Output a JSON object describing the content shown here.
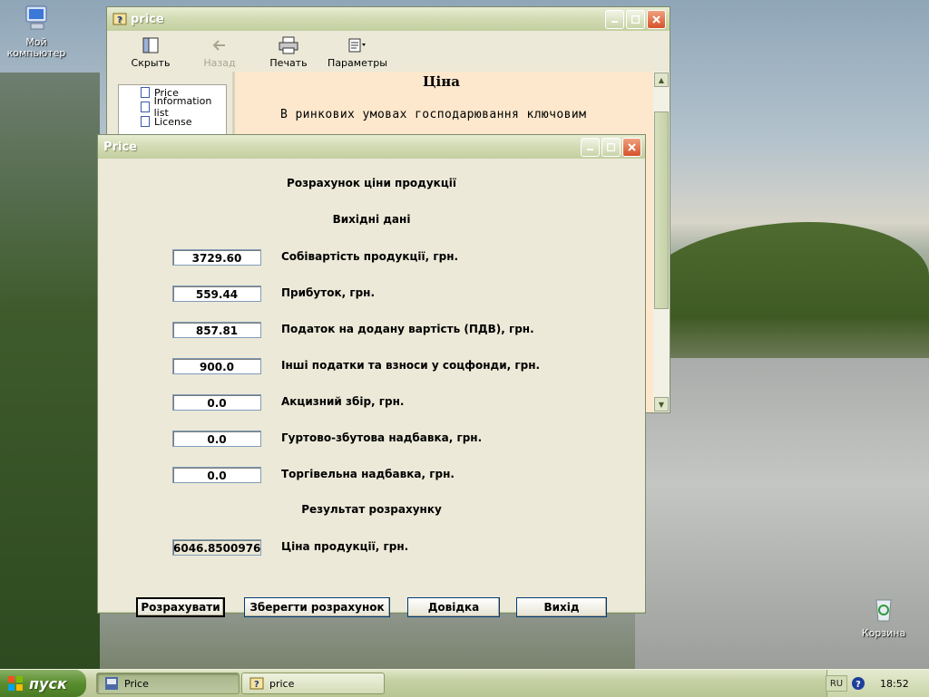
{
  "desktop": {
    "icons": [
      {
        "label_line1": "Мой",
        "label_line2": "компьютер"
      },
      {
        "label_line1": "Корзина",
        "label_line2": ""
      }
    ]
  },
  "help_window": {
    "title": "price",
    "toolbar": [
      {
        "label": "Скрыть",
        "icon": "hide-icon",
        "enabled": true
      },
      {
        "label": "Назад",
        "icon": "back-arrow-icon",
        "enabled": false
      },
      {
        "label": "Печать",
        "icon": "printer-icon",
        "enabled": true
      },
      {
        "label": "Параметры",
        "icon": "options-icon",
        "enabled": true
      }
    ],
    "toc": [
      "Price",
      "Information list",
      "License"
    ],
    "content_title": "Ціна",
    "content_text": "В  ринкових  умовах  господарювання  ключовим"
  },
  "price_dialog": {
    "title": "Price",
    "heading": "Розрахунок ціни продукції",
    "input_heading": "Вихідні дані",
    "fields": [
      {
        "value": "3729.60",
        "label": "Собівартість продукції, грн."
      },
      {
        "value": "559.44",
        "label": "Прибуток, грн."
      },
      {
        "value": "857.81",
        "label": "Податок на додану вартість (ПДВ), грн."
      },
      {
        "value": "900.0",
        "label": "Інші податки та взноси у соцфонди, грн."
      },
      {
        "value": "0.0",
        "label": "Акцизний збір, грн."
      },
      {
        "value": "0.0",
        "label": "Гуртово-збутова надбавка, грн."
      },
      {
        "value": "0.0",
        "label": "Торгівельна надбавка, грн."
      }
    ],
    "result_heading": "Результат розрахунку",
    "result": {
      "value": "6046.8500976",
      "label": "Ціна продукції, грн."
    },
    "buttons": {
      "calculate": "Розрахувати",
      "save": "Зберегти розрахунок",
      "help": "Довідка",
      "exit": "Вихід"
    }
  },
  "taskbar": {
    "start_label": "пуск",
    "tasks": [
      {
        "label": "Price",
        "active": true
      },
      {
        "label": "price",
        "active": false
      }
    ],
    "language": "RU",
    "clock": "18:52"
  }
}
